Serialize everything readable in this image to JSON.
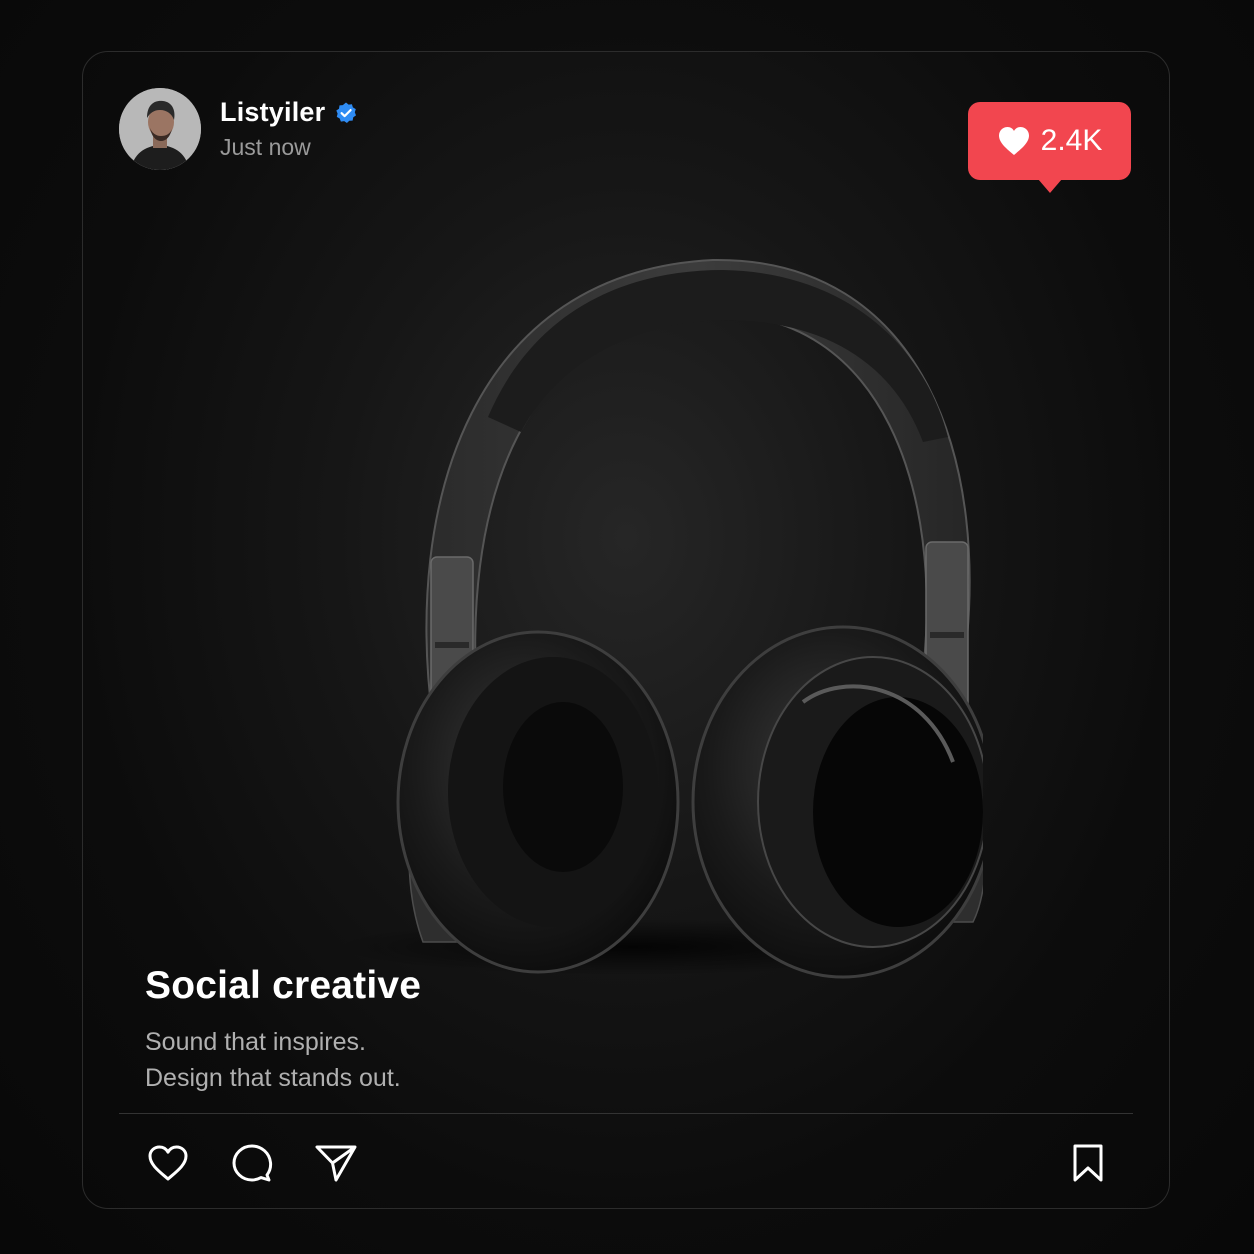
{
  "post": {
    "username": "Listyiler",
    "verified": true,
    "timestamp": "Just now",
    "likes_badge": "2.4K",
    "caption_title": "Social creative",
    "caption_lines": [
      "Sound that inspires.",
      "Design that stands out."
    ]
  },
  "icons": {
    "verified": "verified-check-icon",
    "badge_heart": "heart-filled-icon",
    "like": "heart-outline-icon",
    "comment": "comment-bubble-icon",
    "share": "paper-plane-icon",
    "save": "bookmark-icon"
  },
  "colors": {
    "badge": "#f2464f",
    "verified": "#2f8cf4",
    "background": "#0a0a0a"
  }
}
